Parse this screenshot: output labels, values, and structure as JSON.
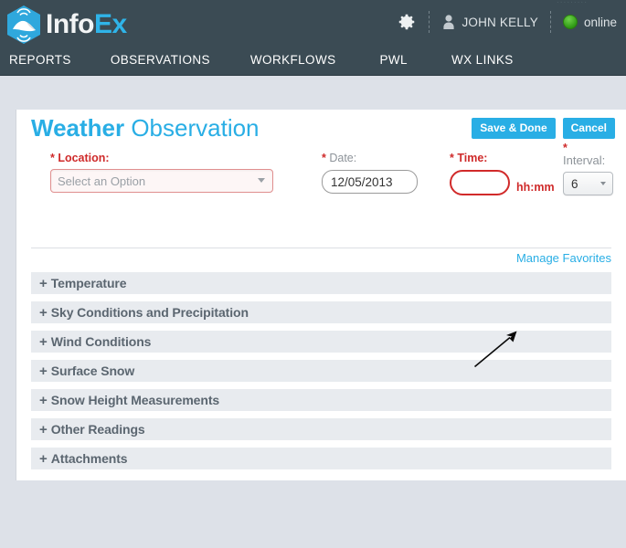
{
  "header": {
    "logo_info": "Info",
    "logo_ex": "Ex",
    "logo_icon": "infoex-hexagon-logo",
    "settings_icon": "gear-icon",
    "user_icon": "user-avatar-icon",
    "user_name": "JOHN KELLY",
    "status_icon": "online-status-dot",
    "status_text": "online",
    "cutoff_text": "........."
  },
  "nav": {
    "items": [
      {
        "label": "REPORTS"
      },
      {
        "label": "OBSERVATIONS"
      },
      {
        "label": "WORKFLOWS"
      },
      {
        "label": "PWL"
      },
      {
        "label": "WX LINKS"
      }
    ]
  },
  "card": {
    "title_bold": "Weather",
    "title_rest": " Observation",
    "save_label": "Save & Done",
    "cancel_label": "Cancel"
  },
  "form": {
    "location": {
      "label": "* Location:",
      "placeholder": "Select an Option",
      "value": "",
      "caret_icon": "chevron-down-icon"
    },
    "date": {
      "label_star": "* ",
      "label": "Date:",
      "value": "12/05/2013"
    },
    "time": {
      "label": "* Time:",
      "value": "",
      "hint": "hh:mm"
    },
    "interval": {
      "star": "*",
      "label": "Interval:",
      "value": "6",
      "caret_icon": "chevron-down-icon"
    }
  },
  "favorites": {
    "link_label": "Manage Favorites"
  },
  "accordion": {
    "plus_icon": "+",
    "sections": [
      {
        "label": "Temperature"
      },
      {
        "label": "Sky Conditions and Precipitation"
      },
      {
        "label": "Wind Conditions"
      },
      {
        "label": "Surface Snow"
      },
      {
        "label": "Snow Height Measurements"
      },
      {
        "label": "Other Readings"
      },
      {
        "label": "Attachments"
      }
    ]
  },
  "annotation": {
    "arrow_name": "pointer-arrow-to-manage-favorites"
  },
  "colors": {
    "header_bg": "#3b4b54",
    "accent_blue": "#29aee5",
    "page_bg": "#dde1e8",
    "required_red": "#cf2a2a",
    "accordion_bg": "#e8ebef",
    "online_green": "#3fa81a"
  }
}
